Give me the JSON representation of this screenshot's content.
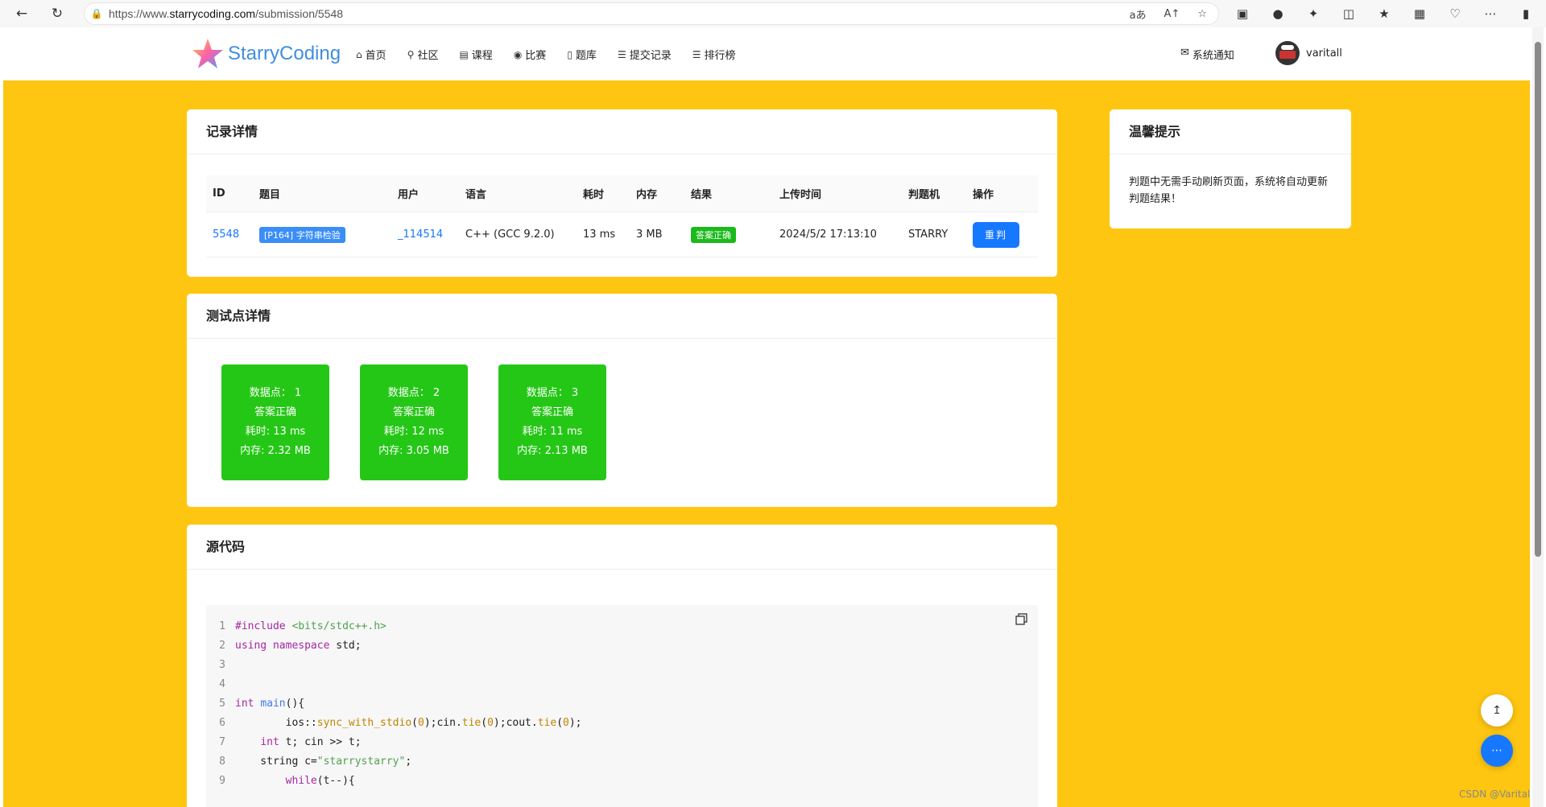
{
  "browser": {
    "url_prefix": "https://www.",
    "url_domain": "starrycoding.com",
    "url_path": "/submission/5548"
  },
  "site": {
    "brand": "StarryCoding",
    "menu": [
      {
        "icon": "home-icon",
        "label": "首页"
      },
      {
        "icon": "location-icon",
        "label": "社区"
      },
      {
        "icon": "book-icon",
        "label": "课程"
      },
      {
        "icon": "fire-icon",
        "label": "比赛"
      },
      {
        "icon": "bookmark-icon",
        "label": "题库"
      },
      {
        "icon": "list-icon",
        "label": "提交记录"
      },
      {
        "icon": "list-icon",
        "label": "排行榜"
      }
    ],
    "notice": "系统通知",
    "username": "varitall"
  },
  "record": {
    "title": "记录详情",
    "headers": [
      "ID",
      "题目",
      "用户",
      "语言",
      "耗时",
      "内存",
      "结果",
      "上传时间",
      "判题机",
      "操作"
    ],
    "row": {
      "id": "5548",
      "problem": "[P164] 字符串检验",
      "user": "_114514",
      "language": "C++ (GCC 9.2.0)",
      "time": "13 ms",
      "memory": "3 MB",
      "result": "答案正确",
      "upload_time": "2024/5/2 17:13:10",
      "judge": "STARRY",
      "action": "重判"
    }
  },
  "tips": {
    "title": "温馨提示",
    "text": "判题中无需手动刷新页面，系统将自动更新判题结果！"
  },
  "tests": {
    "title": "测试点详情",
    "items": [
      {
        "point": "数据点： 1",
        "status": "答案正确",
        "time": "耗时: 13 ms",
        "memory": "内存: 2.32 MB"
      },
      {
        "point": "数据点： 2",
        "status": "答案正确",
        "time": "耗时: 12 ms",
        "memory": "内存: 3.05 MB"
      },
      {
        "point": "数据点： 3",
        "status": "答案正确",
        "time": "耗时: 11 ms",
        "memory": "内存: 2.13 MB"
      }
    ]
  },
  "source": {
    "title": "源代码",
    "lines": [
      "#include <bits/stdc++.h>",
      "using namespace std;",
      "",
      "",
      "int main(){",
      "        ios::sync_with_stdio(0);cin.tie(0);cout.tie(0);",
      "    int t; cin >> t;",
      "    string c=\"starrystarry\";",
      "        while(t--){"
    ]
  },
  "watermark": "CSDN @Varitall",
  "colors": {
    "page_bg": "#fec611",
    "accent": "#1677ff",
    "success": "#25c716"
  }
}
